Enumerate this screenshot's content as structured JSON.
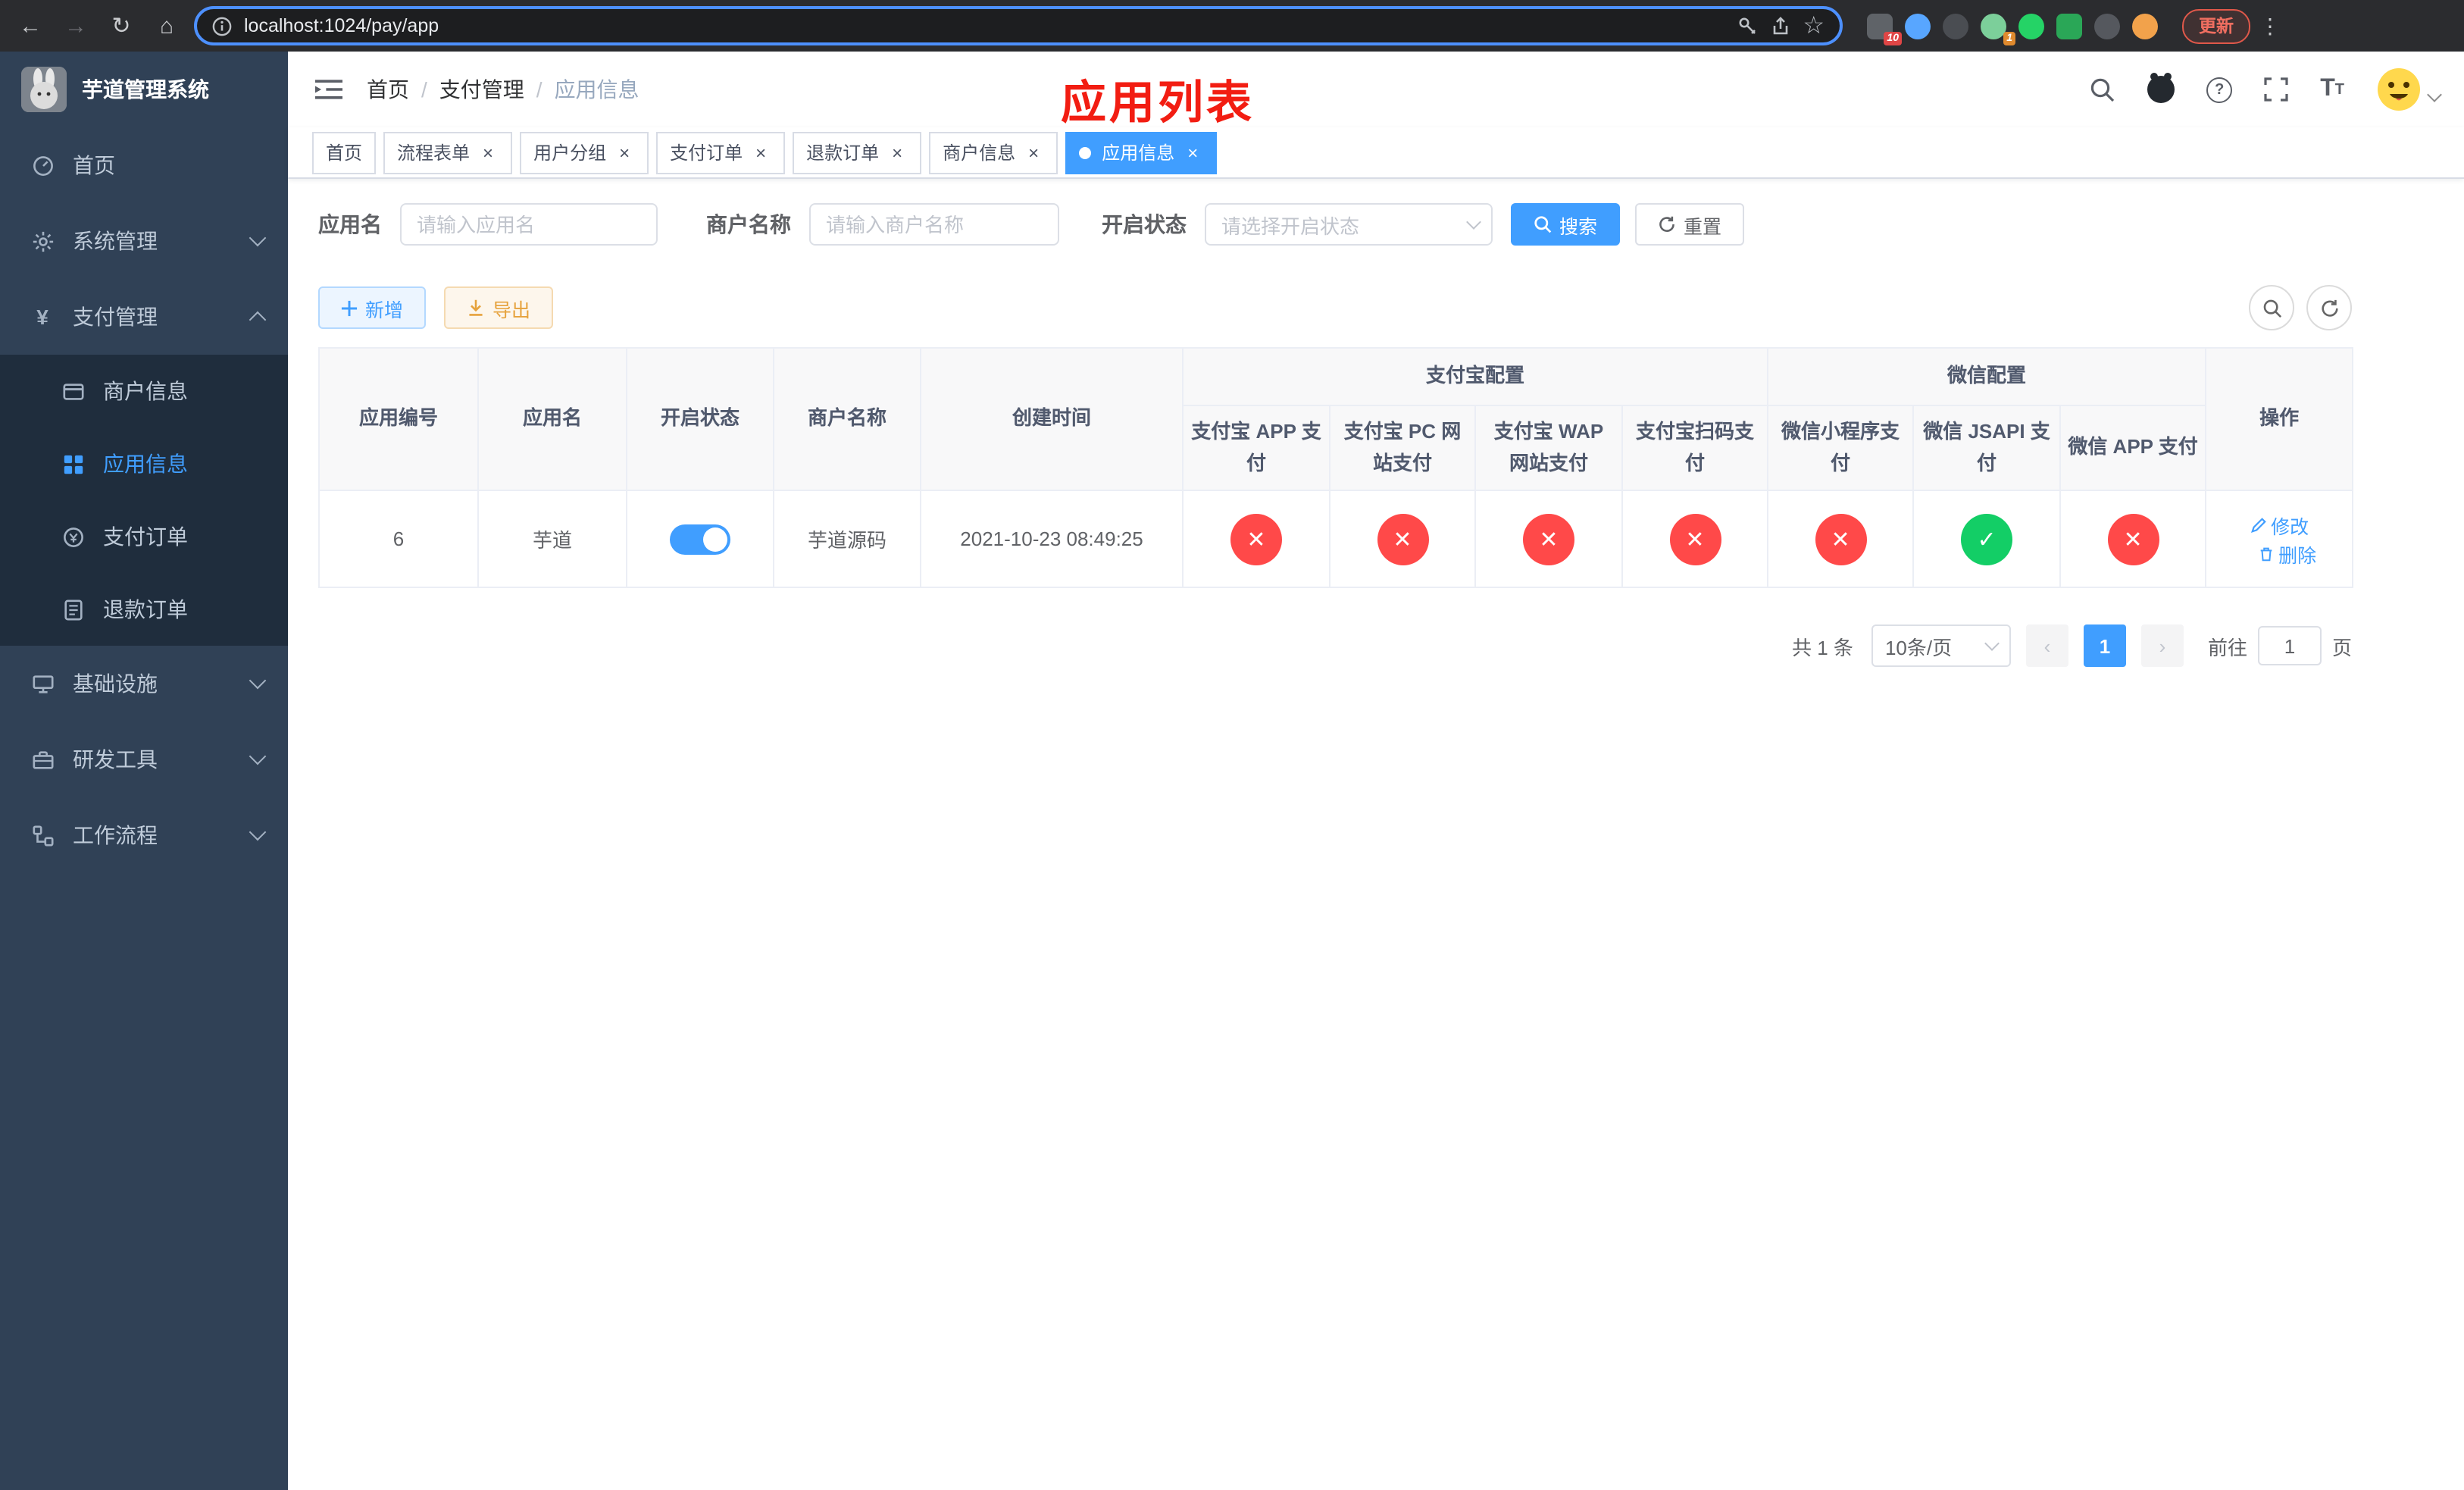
{
  "colors": {
    "accent": "#409eff",
    "danger": "#ff4949",
    "success": "#13ce66",
    "annotation_red": "#f21d12",
    "sidebar_bg": "#304156",
    "submenu_bg": "#1f2d3d"
  },
  "browser": {
    "url": "localhost:1024/pay/app",
    "update_label": "更新",
    "extension_badge_1": "10",
    "extension_badge_2": "1"
  },
  "sidebar": {
    "title": "芋道管理系统",
    "items": [
      {
        "label": "首页"
      },
      {
        "label": "系统管理"
      },
      {
        "label": "支付管理"
      },
      {
        "label": "商户信息"
      },
      {
        "label": "应用信息"
      },
      {
        "label": "支付订单"
      },
      {
        "label": "退款订单"
      },
      {
        "label": "基础设施"
      },
      {
        "label": "研发工具"
      },
      {
        "label": "工作流程"
      }
    ]
  },
  "header": {
    "breadcrumb": [
      "首页",
      "支付管理",
      "应用信息"
    ],
    "annotation": "应用列表"
  },
  "tabs": [
    {
      "label": "首页"
    },
    {
      "label": "流程表单"
    },
    {
      "label": "用户分组"
    },
    {
      "label": "支付订单"
    },
    {
      "label": "退款订单"
    },
    {
      "label": "商户信息"
    },
    {
      "label": "应用信息"
    }
  ],
  "filters": {
    "app_name_label": "应用名",
    "app_name_placeholder": "请输入应用名",
    "merchant_label": "商户名称",
    "merchant_placeholder": "请输入商户名称",
    "status_label": "开启状态",
    "status_placeholder": "请选择开启状态",
    "search_label": "搜索",
    "reset_label": "重置"
  },
  "toolbar": {
    "add_label": "新增",
    "export_label": "导出"
  },
  "table": {
    "columns": {
      "id": "应用编号",
      "name": "应用名",
      "status": "开启状态",
      "merchant": "商户名称",
      "created": "创建时间",
      "actions": "操作"
    },
    "groups": {
      "alipay": "支付宝配置",
      "wechat": "微信配置"
    },
    "sub_headers": [
      "支付宝 APP 支付",
      "支付宝 PC 网站支付",
      "支付宝 WAP 网站支付",
      "支付宝扫码支付",
      "微信小程序支付",
      "微信 JSAPI 支付",
      "微信 APP 支付"
    ],
    "row": {
      "id": "6",
      "name": "芋道",
      "enabled": true,
      "merchant": "芋道源码",
      "created": "2021-10-23 08:49:25",
      "statuses": [
        false,
        false,
        false,
        false,
        false,
        true,
        false
      ],
      "action_edit": "修改",
      "action_delete": "删除"
    }
  },
  "pagination": {
    "total": "共 1 条",
    "page_size": "10条/页",
    "page": "1",
    "goto_prefix": "前往",
    "goto_value": "1",
    "goto_suffix": "页"
  }
}
